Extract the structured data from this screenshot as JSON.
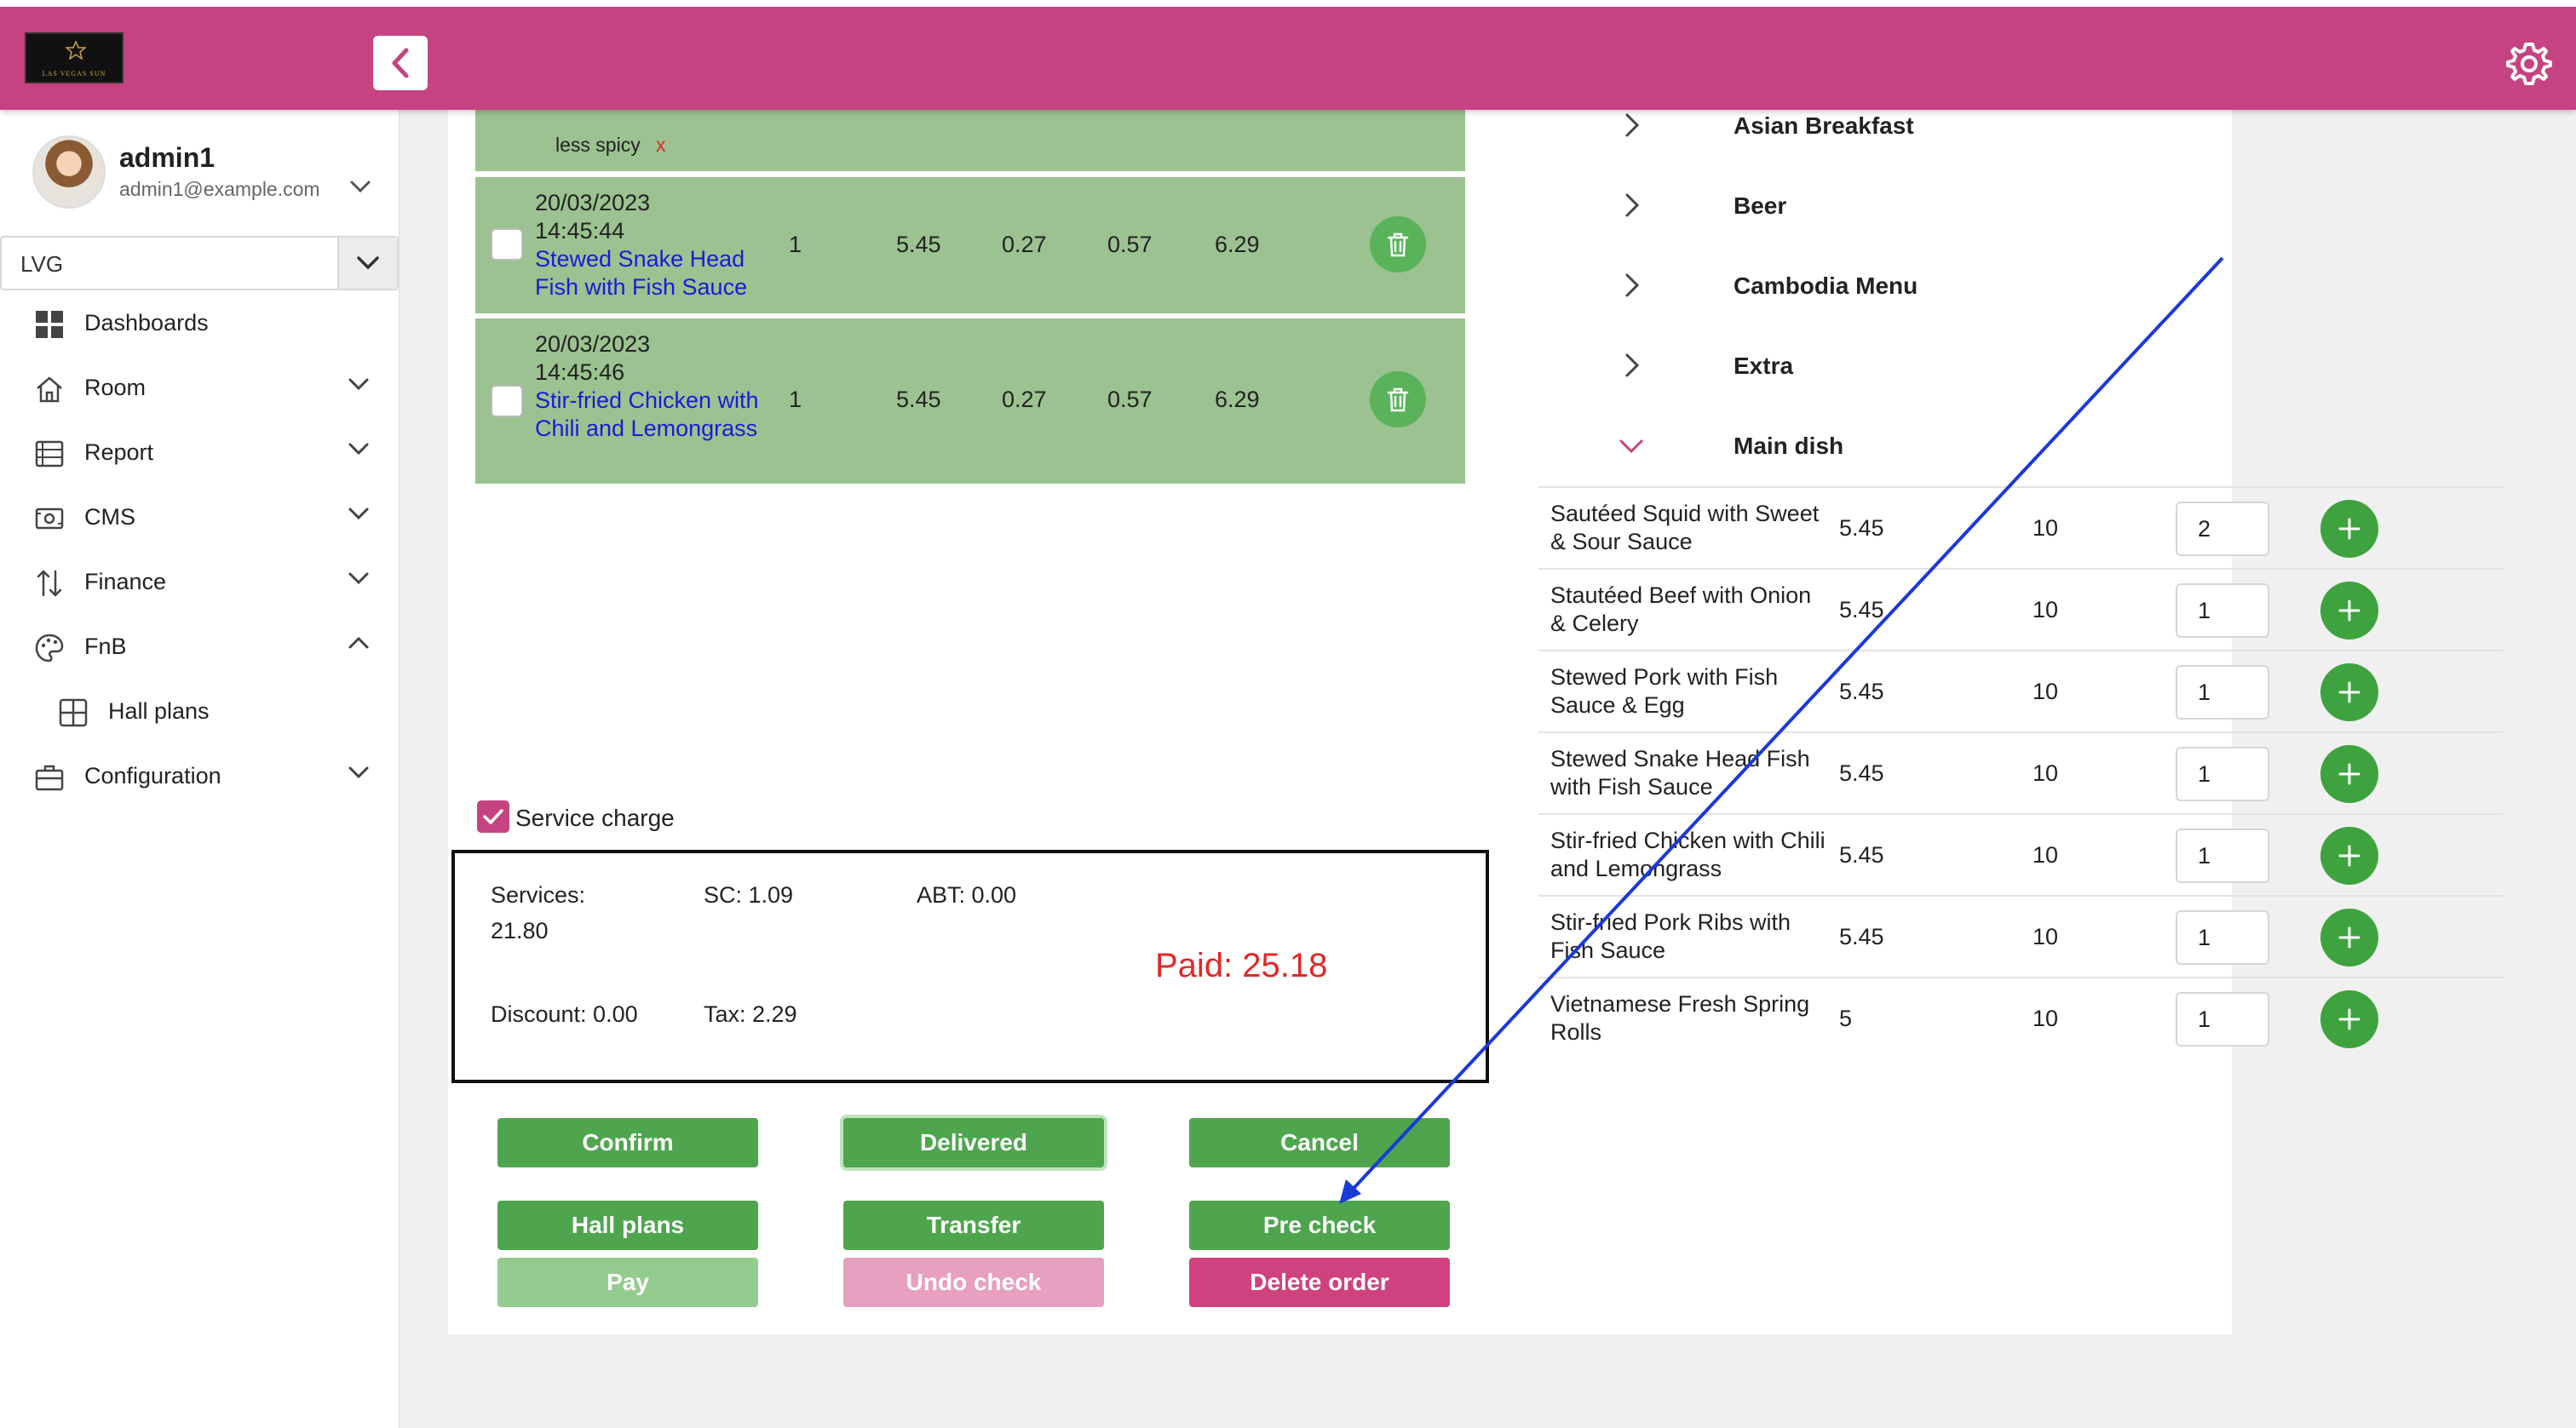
{
  "header": {
    "logo_text": "LAS VEGAS SUN",
    "collapse_icon": "chevron-left-icon",
    "settings_icon": "gear-icon",
    "accent_color": "#c64381"
  },
  "sidebar": {
    "user": {
      "name": "admin1",
      "email": "admin1@example.com"
    },
    "location_select": {
      "value": "LVG"
    },
    "items": [
      {
        "label": "Dashboards",
        "icon": "dashboard-icon"
      },
      {
        "label": "Room",
        "icon": "home-icon"
      },
      {
        "label": "Report",
        "icon": "report-icon"
      },
      {
        "label": "CMS",
        "icon": "cms-icon"
      },
      {
        "label": "Finance",
        "icon": "sort-arrows-icon"
      },
      {
        "label": "FnB",
        "icon": "palette-icon"
      },
      {
        "label": "Hall plans",
        "icon": "grid-icon"
      },
      {
        "label": "Configuration",
        "icon": "briefcase-icon"
      }
    ]
  },
  "order": {
    "note": {
      "text": "less spicy",
      "remove": "x"
    },
    "items": [
      {
        "date": "20/03/2023",
        "time": "14:45:44",
        "dish": "Stewed Snake Head Fish with Fish Sauce",
        "qty": "1",
        "price": "5.45",
        "sc": "0.27",
        "tax": "0.57",
        "total": "6.29"
      },
      {
        "date": "20/03/2023",
        "time": "14:45:46",
        "dish": "Stir-fried Chicken with Chili and Lemongrass",
        "qty": "1",
        "price": "5.45",
        "sc": "0.27",
        "tax": "0.57",
        "total": "6.29"
      }
    ],
    "service_charge_label": "Service charge",
    "service_charge_checked": true
  },
  "summary": {
    "services_label": "Services:",
    "services_value": "21.80",
    "sc": "SC: 1.09",
    "abt": "ABT: 0.00",
    "discount": "Discount: 0.00",
    "tax": "Tax: 2.29",
    "paid": "Paid: 25.18"
  },
  "actions": {
    "confirm": "Confirm",
    "delivered": "Delivered",
    "cancel": "Cancel",
    "hall_plans": "Hall plans",
    "transfer": "Transfer",
    "pre_check": "Pre check",
    "pay": "Pay",
    "undo_check": "Undo check",
    "delete_order": "Delete order"
  },
  "menu": {
    "categories": [
      {
        "label": "Asian Breakfast",
        "expanded": false
      },
      {
        "label": "Beer",
        "expanded": false
      },
      {
        "label": "Cambodia Menu",
        "expanded": false
      },
      {
        "label": "Extra",
        "expanded": false
      },
      {
        "label": "Main dish",
        "expanded": true
      }
    ],
    "dishes": [
      {
        "name": "Sautéed Squid with Sweet & Sour Sauce",
        "price": "5.45",
        "stock": "10",
        "qty": "2"
      },
      {
        "name": "Stautéed Beef with Onion & Celery",
        "price": "5.45",
        "stock": "10",
        "qty": "1"
      },
      {
        "name": "Stewed Pork with Fish Sauce & Egg",
        "price": "5.45",
        "stock": "10",
        "qty": "1"
      },
      {
        "name": "Stewed Snake Head Fish with Fish Sauce",
        "price": "5.45",
        "stock": "10",
        "qty": "1"
      },
      {
        "name": "Stir-fried Chicken with Chili and Lemongrass",
        "price": "5.45",
        "stock": "10",
        "qty": "1"
      },
      {
        "name": "Stir-fried Pork Ribs with Fish Sauce",
        "price": "5.45",
        "stock": "10",
        "qty": "1"
      },
      {
        "name": "Vietnamese Fresh Spring Rolls",
        "price": "5",
        "stock": "10",
        "qty": "1"
      }
    ]
  },
  "annotation": {
    "type": "arrow",
    "color": "#1a3ad8",
    "points_to": "Pre check"
  }
}
